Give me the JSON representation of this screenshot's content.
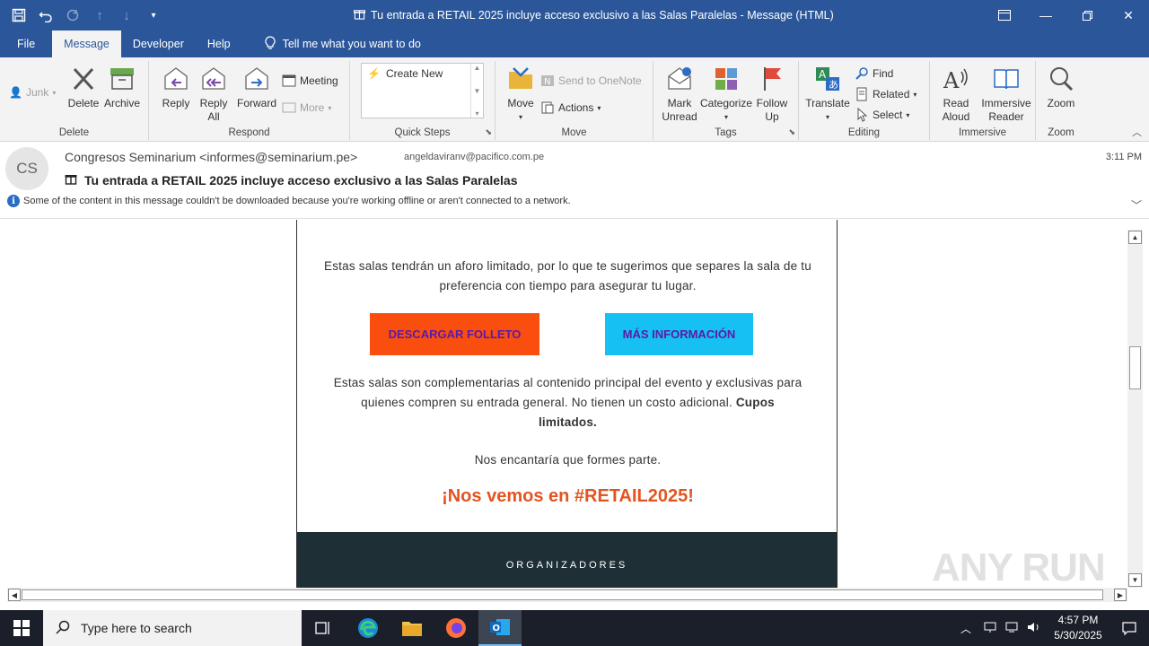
{
  "window": {
    "title": "Tu entrada a RETAIL 2025 incluye acceso exclusivo a las Salas Paralelas  -  Message (HTML)"
  },
  "tabs": [
    "File",
    "Message",
    "Developer",
    "Help"
  ],
  "tell_me": "Tell me what you want to do",
  "ribbon": {
    "junk": "Junk",
    "delete": "Delete",
    "archive": "Archive",
    "group_delete": "Delete",
    "reply": "Reply",
    "reply_all": "Reply All",
    "forward": "Forward",
    "meeting": "Meeting",
    "more": "More",
    "group_respond": "Respond",
    "create_new": "Create New",
    "group_quicksteps": "Quick Steps",
    "move": "Move",
    "send_onenote": "Send to OneNote",
    "actions": "Actions",
    "group_move": "Move",
    "mark_unread": "Mark Unread",
    "categorize": "Categorize",
    "follow_up": "Follow Up",
    "group_tags": "Tags",
    "translate": "Translate",
    "find": "Find",
    "related": "Related",
    "select": "Select",
    "group_editing": "Editing",
    "read_aloud": "Read Aloud",
    "immersive_reader": "Immersive Reader",
    "group_immersive": "Immersive",
    "zoom": "Zoom",
    "group_zoom": "Zoom"
  },
  "message": {
    "avatar_initials": "CS",
    "sender": "Congresos Seminarium <informes@seminarium.pe>",
    "to": "angeldaviranv@pacifico.com.pe",
    "time": "3:11 PM",
    "subject": "Tu entrada a RETAIL 2025 incluye acceso exclusivo a las Salas Paralelas",
    "info_bar": "Some of the content in this message couldn't be downloaded because you're working offline or aren't connected to a network."
  },
  "email_body": {
    "para1": "Estas salas tendrán un aforo limitado, por lo que te sugerimos que separes la sala de tu preferencia con tiempo para asegurar tu lugar.",
    "btn_download": "DESCARGAR FOLLETO",
    "btn_info": "MÁS INFORMACIÓN",
    "para2_normal": "Estas salas son complementarias al contenido principal del evento y exclusivas para quienes compren su entrada general. No tienen un costo adicional. ",
    "para2_bold": "Cupos limitados.",
    "para3": "Nos encantaría que formes parte.",
    "cta": "¡Nos vemos en #RETAIL2025!",
    "footer": "ORGANIZADORES"
  },
  "watermark": "ANY RUN",
  "taskbar": {
    "search_placeholder": "Type here to search",
    "time": "4:57 PM",
    "date": "5/30/2025"
  },
  "colors": {
    "accent": "#2b579a",
    "btn_orange": "#fa4e0f",
    "btn_cyan": "#16c0f2",
    "cta_text": "#e4541f",
    "footer_band": "#1e3035"
  }
}
